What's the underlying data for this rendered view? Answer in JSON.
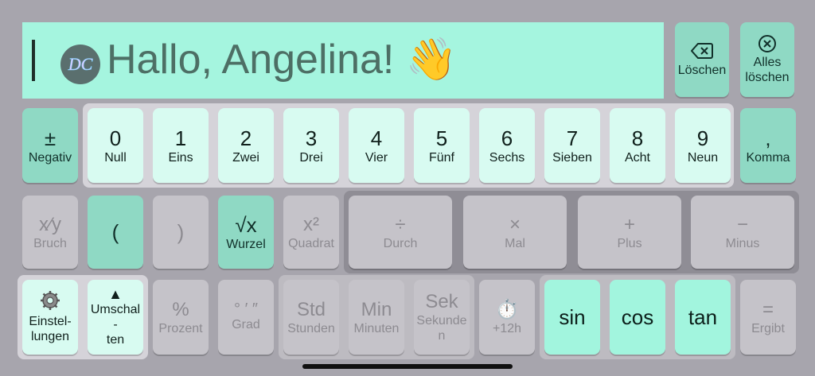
{
  "display": {
    "greeting": "Hallo, Angelina! 👋",
    "logo_text": "DC"
  },
  "actions": {
    "delete_label": "Löschen",
    "delete_all_line1": "Alles",
    "delete_all_line2": "löschen"
  },
  "row1": {
    "negativ_symbol": "±",
    "negativ_label": "Negativ",
    "digits": [
      {
        "digit": "0",
        "word": "Null"
      },
      {
        "digit": "1",
        "word": "Eins"
      },
      {
        "digit": "2",
        "word": "Zwei"
      },
      {
        "digit": "3",
        "word": "Drei"
      },
      {
        "digit": "4",
        "word": "Vier"
      },
      {
        "digit": "5",
        "word": "Fünf"
      },
      {
        "digit": "6",
        "word": "Sechs"
      },
      {
        "digit": "7",
        "word": "Sieben"
      },
      {
        "digit": "8",
        "word": "Acht"
      },
      {
        "digit": "9",
        "word": "Neun"
      }
    ],
    "komma_symbol": ",",
    "komma_label": "Komma"
  },
  "row2": {
    "bruch_symbol": "x⁄y",
    "bruch_label": "Bruch",
    "paren_open": "(",
    "paren_close": ")",
    "wurzel_symbol": "√x",
    "wurzel_label": "Wurzel",
    "quadrat_symbol": "x²",
    "quadrat_label": "Quadrat",
    "ops": [
      {
        "symbol": "÷",
        "label": "Durch"
      },
      {
        "symbol": "×",
        "label": "Mal"
      },
      {
        "symbol": "+",
        "label": "Plus"
      },
      {
        "symbol": "−",
        "label": "Minus"
      }
    ]
  },
  "row3": {
    "settings_line1": "Einstel-",
    "settings_line2": "lungen",
    "shift_symbol": "▲",
    "shift_line1": "Umschal",
    "shift_line2": "-",
    "shift_line3": "ten",
    "prozent_symbol": "%",
    "prozent_label": "Prozent",
    "grad_symbol": "° ′ ″",
    "grad_label": "Grad",
    "std_symbol": "Std",
    "std_label": "Stunden",
    "min_symbol": "Min",
    "min_label": "Minuten",
    "sek_symbol": "Sek",
    "sek_label_line1": "Sekunde",
    "sek_label_line2": "n",
    "clock_symbol": "⏱️",
    "clock_label": "+12h",
    "sin": "sin",
    "cos": "cos",
    "tan": "tan",
    "ergibt_symbol": "=",
    "ergibt_label": "Ergibt"
  },
  "colors": {
    "background": "#a7a5ad",
    "display": "#a5f5df",
    "accent_key": "#8fd9c4",
    "digit_key": "#d8fbf1",
    "trig_key": "#a2f5de",
    "disabled_key": "#c5c3c9"
  }
}
